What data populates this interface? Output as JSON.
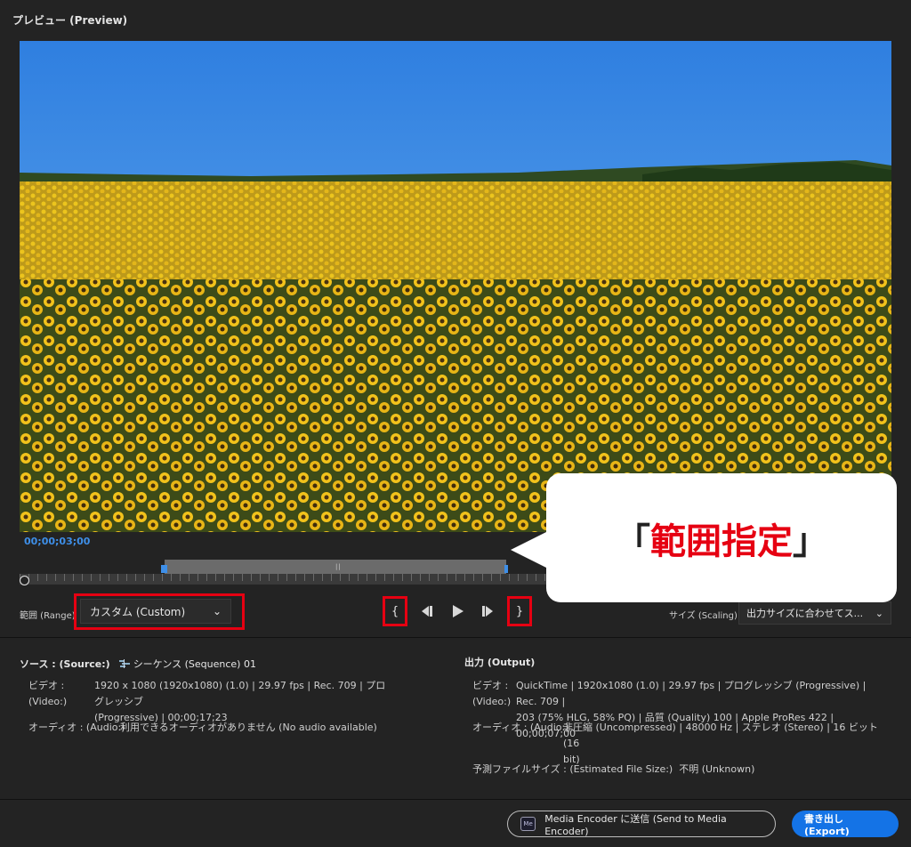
{
  "panel": {
    "title": "プレビュー (Preview)"
  },
  "preview": {
    "timecode": "00;00;03;00"
  },
  "range": {
    "label": "範囲 (Range)",
    "selected": "カスタム (Custom)"
  },
  "transport": {
    "mark_in_icon": "{",
    "step_back_icon": "step-back-icon",
    "play_icon": "play-icon",
    "step_forward_icon": "step-forward-icon",
    "mark_out_icon": "}"
  },
  "scaling": {
    "label": "サイズ (Scaling)",
    "selected": "出力サイズに合わせてス..."
  },
  "callout": {
    "open": "「",
    "text": "範囲指定",
    "close": "」"
  },
  "source": {
    "title": "ソース : (Source:)",
    "sequence": "シーケンス (Sequence) 01",
    "video_label_1": "ビデオ :",
    "video_label_2": "(Video:)",
    "video_line_1": "1920 x 1080 (1920x1080) (1.0) | 29.97 fps | Rec. 709 | プログレッシブ",
    "video_line_2": "(Progressive) | 00;00;17;23",
    "audio_label": "オーディオ : (Audio:)",
    "audio_value": "利用できるオーディオがありません (No audio available)"
  },
  "output": {
    "title": "出力 (Output)",
    "video_label_1": "ビデオ :",
    "video_label_2": "(Video:)",
    "video_line_1": "QuickTime | 1920x1080 (1.0) | 29.97 fps | プログレッシブ (Progressive) | Rec. 709 |",
    "video_line_2": "203 (75% HLG, 58% PQ) | 品質 (Quality) 100 | Apple ProRes 422 | 00;00;07;00",
    "audio_label": "オーディオ : (Audio:)",
    "audio_line_1": "非圧縮 (Uncompressed) | 48000 Hz | ステレオ (Stereo) | 16 ビット (16",
    "audio_line_2": "bit)",
    "filesize_label": "予測ファイルサイズ : (Estimated File Size:)",
    "filesize_value": "不明 (Unknown)"
  },
  "footer": {
    "me_badge": "Me",
    "send_label": "Media Encoder に送信 (Send to Media Encoder)",
    "export_label": "書き出し (Export)"
  },
  "colors": {
    "accent": "#1473e6",
    "highlight": "#e60012",
    "timecode": "#3e8fe8"
  }
}
